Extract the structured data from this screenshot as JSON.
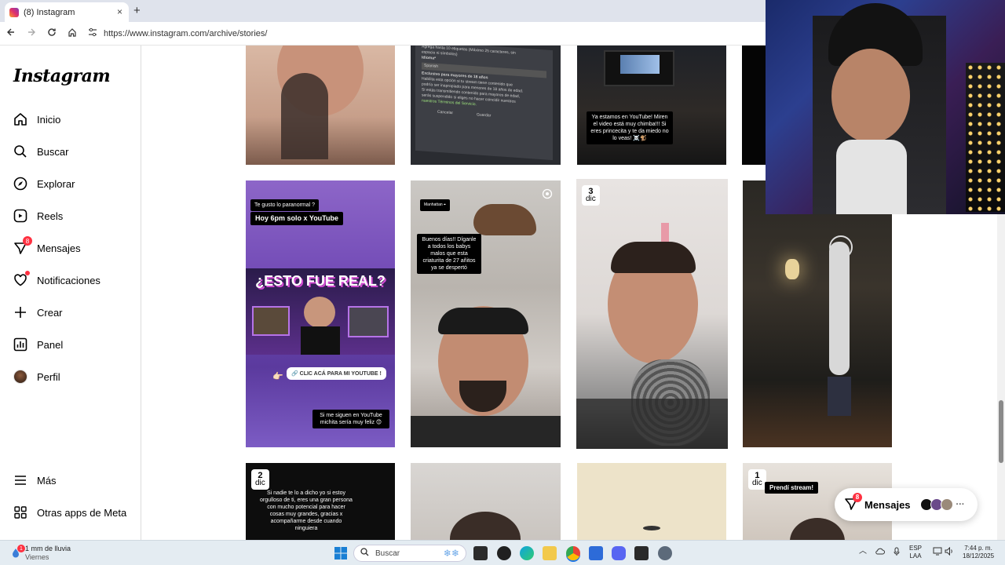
{
  "browser": {
    "tab_title": "(8) Instagram",
    "url": "https://www.instagram.com/archive/stories/",
    "new_tab": "+",
    "close": "×"
  },
  "sidebar": {
    "logo": "Instagram",
    "items": [
      {
        "label": "Inicio",
        "icon": "home-icon"
      },
      {
        "label": "Buscar",
        "icon": "search-icon"
      },
      {
        "label": "Explorar",
        "icon": "explore-icon"
      },
      {
        "label": "Reels",
        "icon": "reels-icon"
      },
      {
        "label": "Mensajes",
        "icon": "messenger-icon",
        "badge": "8"
      },
      {
        "label": "Notificaciones",
        "icon": "heart-icon"
      },
      {
        "label": "Crear",
        "icon": "plus-icon"
      },
      {
        "label": "Panel",
        "icon": "chart-icon"
      },
      {
        "label": "Perfil",
        "icon": "avatar"
      }
    ],
    "more": "Más",
    "meta_apps": "Otras apps de Meta"
  },
  "stories": {
    "row1": {
      "tile2_lines": [
        "Agrega hasta 10 etiquetas (Máximo 25 caracteres, sin",
        "espacio ni símbolos)",
        "Idioma*",
        "Spanish",
        "Exclusivo para mayores de 18 años",
        "Habilita esta opción si tu stream tiene contenido que",
        "podría ser inapropiado para menores de 18 años de edad.",
        "Si estás transmitiendo contenido para mayores de edad,",
        "serás suspendido si eliges no hacer coincidir nuestros",
        "nuestros Términos del Servicio.",
        "Cancelar",
        "Guardar"
      ],
      "tile3_caption": "Ya estamos en YouTube! Miren el video está muy chimba!!! Si eres princecita y te da miedo no lo veas! ☠️🐒"
    },
    "row2": {
      "tile1_caption_top": "Te gusto lo paranormal ?",
      "tile1_caption_2": "Hoy 6pm solo x YouTube",
      "tile1_headline": "¿ESTO FUE REAL?",
      "tile1_link": "🔗 CLIC ACÁ PARA MI YOUTUBE !",
      "tile1_pointer": "👉🏻",
      "tile1_caption_bottom": "Si me siguen en YouTube michita sería muy feliz 😊",
      "tile2_location": "Manhattan ⌖",
      "tile2_caption": "Buenos días!! Díganle a todos los babys malos que esta criaturita de 27 añitos ya se despertó",
      "tile3_date_day": "3",
      "tile3_date_month": "dic"
    },
    "row3": {
      "tile1_date_day": "2",
      "tile1_date_month": "dic",
      "tile1_caption": "Si nadie te lo a dicho yo si estoy orgulloso de ti, eres una gran persona con mucho potencial para hacer cosas muy grandes, gracias x acompañarme desde cuando ninguiera",
      "tile4_date_day": "1",
      "tile4_date_month": "dic",
      "tile4_caption": "Prendí stream!"
    }
  },
  "messages_pill": {
    "label": "Mensajes",
    "badge": "8",
    "more": "···"
  },
  "taskbar": {
    "weather_line1": "1 mm de lluvia",
    "weather_line2": "Viernes",
    "weather_badge": "1",
    "search_placeholder": "Buscar",
    "lang_line1": "ESP",
    "lang_line2": "LAA",
    "time": "7:44 p. m.",
    "date": "18/12/2025"
  },
  "colors": {
    "accent": "#ff3040",
    "sidebar_border": "#dbdbdb"
  }
}
